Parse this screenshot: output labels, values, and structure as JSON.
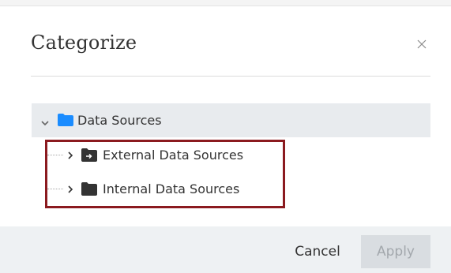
{
  "dialog": {
    "title": "Categorize",
    "close_icon": "close-icon"
  },
  "tree": {
    "root": {
      "label": "Data Sources",
      "expanded": true,
      "icon": "folder-icon",
      "icon_color": "#1a8cff"
    },
    "children": [
      {
        "label": "External Data Sources",
        "expanded": false,
        "icon": "external-folder-icon"
      },
      {
        "label": "Internal Data Sources",
        "expanded": false,
        "icon": "folder-icon"
      }
    ]
  },
  "footer": {
    "cancel_label": "Cancel",
    "apply_label": "Apply",
    "apply_enabled": false
  },
  "colors": {
    "highlight": "#8b1a1f",
    "root_row_background": "#e8ebee",
    "footer_background": "#eef1f3",
    "dark_folder": "#333333"
  }
}
